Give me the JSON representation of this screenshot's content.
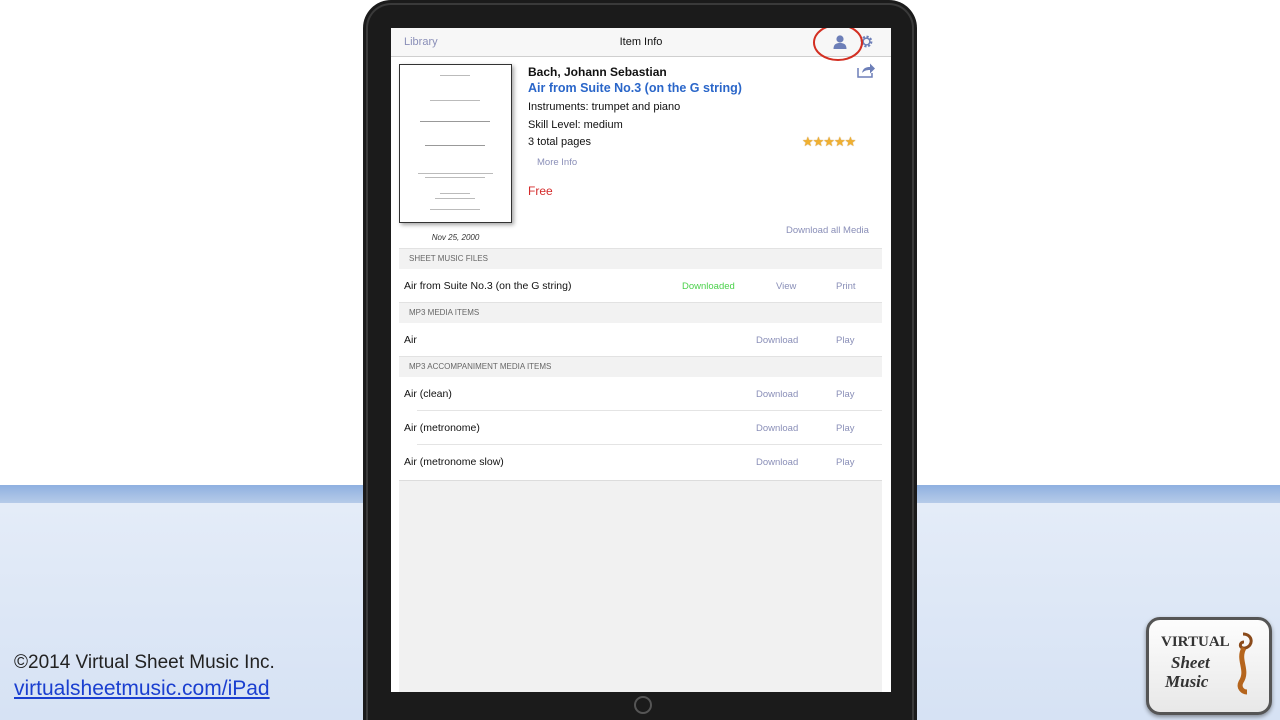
{
  "footer": {
    "copyright": "©2014 Virtual Sheet Music Inc.",
    "link": "virtualsheetmusic.com/iPad"
  },
  "logo": {
    "line1": "VIRTUAL",
    "line2": "Sheet",
    "line3": "Music"
  },
  "navbar": {
    "back_label": "Library",
    "title": "Item Info"
  },
  "item": {
    "composer": "Bach, Johann Sebastian",
    "title": "Air from Suite No.3 (on the G string)",
    "instruments": "Instruments: trumpet and piano",
    "skill": "Skill Level: medium",
    "pages": "3 total pages",
    "more_info": "More Info",
    "price": "Free",
    "price_color": "#d42a2a",
    "rating": 5,
    "stars": "★★★★★",
    "date": "Nov 25, 2000",
    "download_all": "Download all Media"
  },
  "colors": {
    "title": "#2a66c9",
    "link": "#8a8fb8",
    "downloaded": "#4bd14b",
    "highlight_circle": "#d32f22"
  },
  "sections": {
    "sheet": {
      "header": "SHEET MUSIC FILES",
      "rows": [
        {
          "name": "Air from Suite No.3 (on the G string)",
          "status": "Downloaded",
          "action1": "View",
          "action2": "Print"
        }
      ]
    },
    "mp3": {
      "header": "MP3 MEDIA ITEMS",
      "rows": [
        {
          "name": "Air",
          "action1": "Download",
          "action2": "Play"
        }
      ]
    },
    "accomp": {
      "header": "MP3 ACCOMPANIMENT MEDIA ITEMS",
      "rows": [
        {
          "name": "Air (clean)",
          "action1": "Download",
          "action2": "Play"
        },
        {
          "name": "Air (metronome)",
          "action1": "Download",
          "action2": "Play"
        },
        {
          "name": "Air (metronome slow)",
          "action1": "Download",
          "action2": "Play"
        }
      ]
    }
  },
  "icons": {
    "user": "user-icon",
    "settings": "gear-icon",
    "share": "share-icon",
    "home": "home-button-icon"
  }
}
